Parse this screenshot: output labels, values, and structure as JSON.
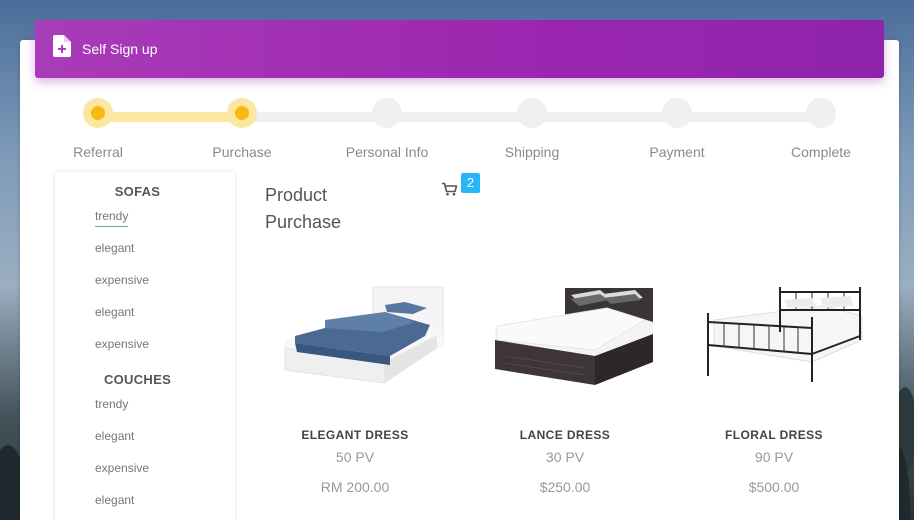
{
  "header": {
    "title": "Self Sign up",
    "icon": "document-add-icon"
  },
  "colors": {
    "accent": "#9c27b0",
    "step_done": "#f9b90e",
    "step_done_halo": "#fbe6a2",
    "step_todo": "#f0f0f0",
    "badge": "#29b6f6",
    "underline": "#4db6ac"
  },
  "stepper": {
    "steps": [
      {
        "label": "Referral",
        "state": "done"
      },
      {
        "label": "Purchase",
        "state": "current"
      },
      {
        "label": "Personal Info",
        "state": "todo"
      },
      {
        "label": "Shipping",
        "state": "todo"
      },
      {
        "label": "Payment",
        "state": "todo"
      },
      {
        "label": "Complete",
        "state": "todo"
      }
    ]
  },
  "sidebar": {
    "categories": [
      {
        "title": "SOFAS",
        "items": [
          "trendy",
          "elegant",
          "expensive",
          "elegant",
          "expensive"
        ],
        "active_index": 0
      },
      {
        "title": "COUCHES",
        "items": [
          "trendy",
          "elegant",
          "expensive",
          "elegant"
        ]
      }
    ]
  },
  "main": {
    "heading": "Product Purchase",
    "cart": {
      "icon": "cart-icon",
      "count": "2"
    },
    "products": [
      {
        "name": "ELEGANT DRESS",
        "pv": "50 PV",
        "price": "RM 200.00",
        "image": "white-bed-blue-blanket"
      },
      {
        "name": "LANCE DRESS",
        "pv": "30 PV",
        "price": "$250.00",
        "image": "dark-wood-bed"
      },
      {
        "name": "FLORAL DRESS",
        "pv": "90 PV",
        "price": "$500.00",
        "image": "black-metal-bed"
      }
    ]
  }
}
